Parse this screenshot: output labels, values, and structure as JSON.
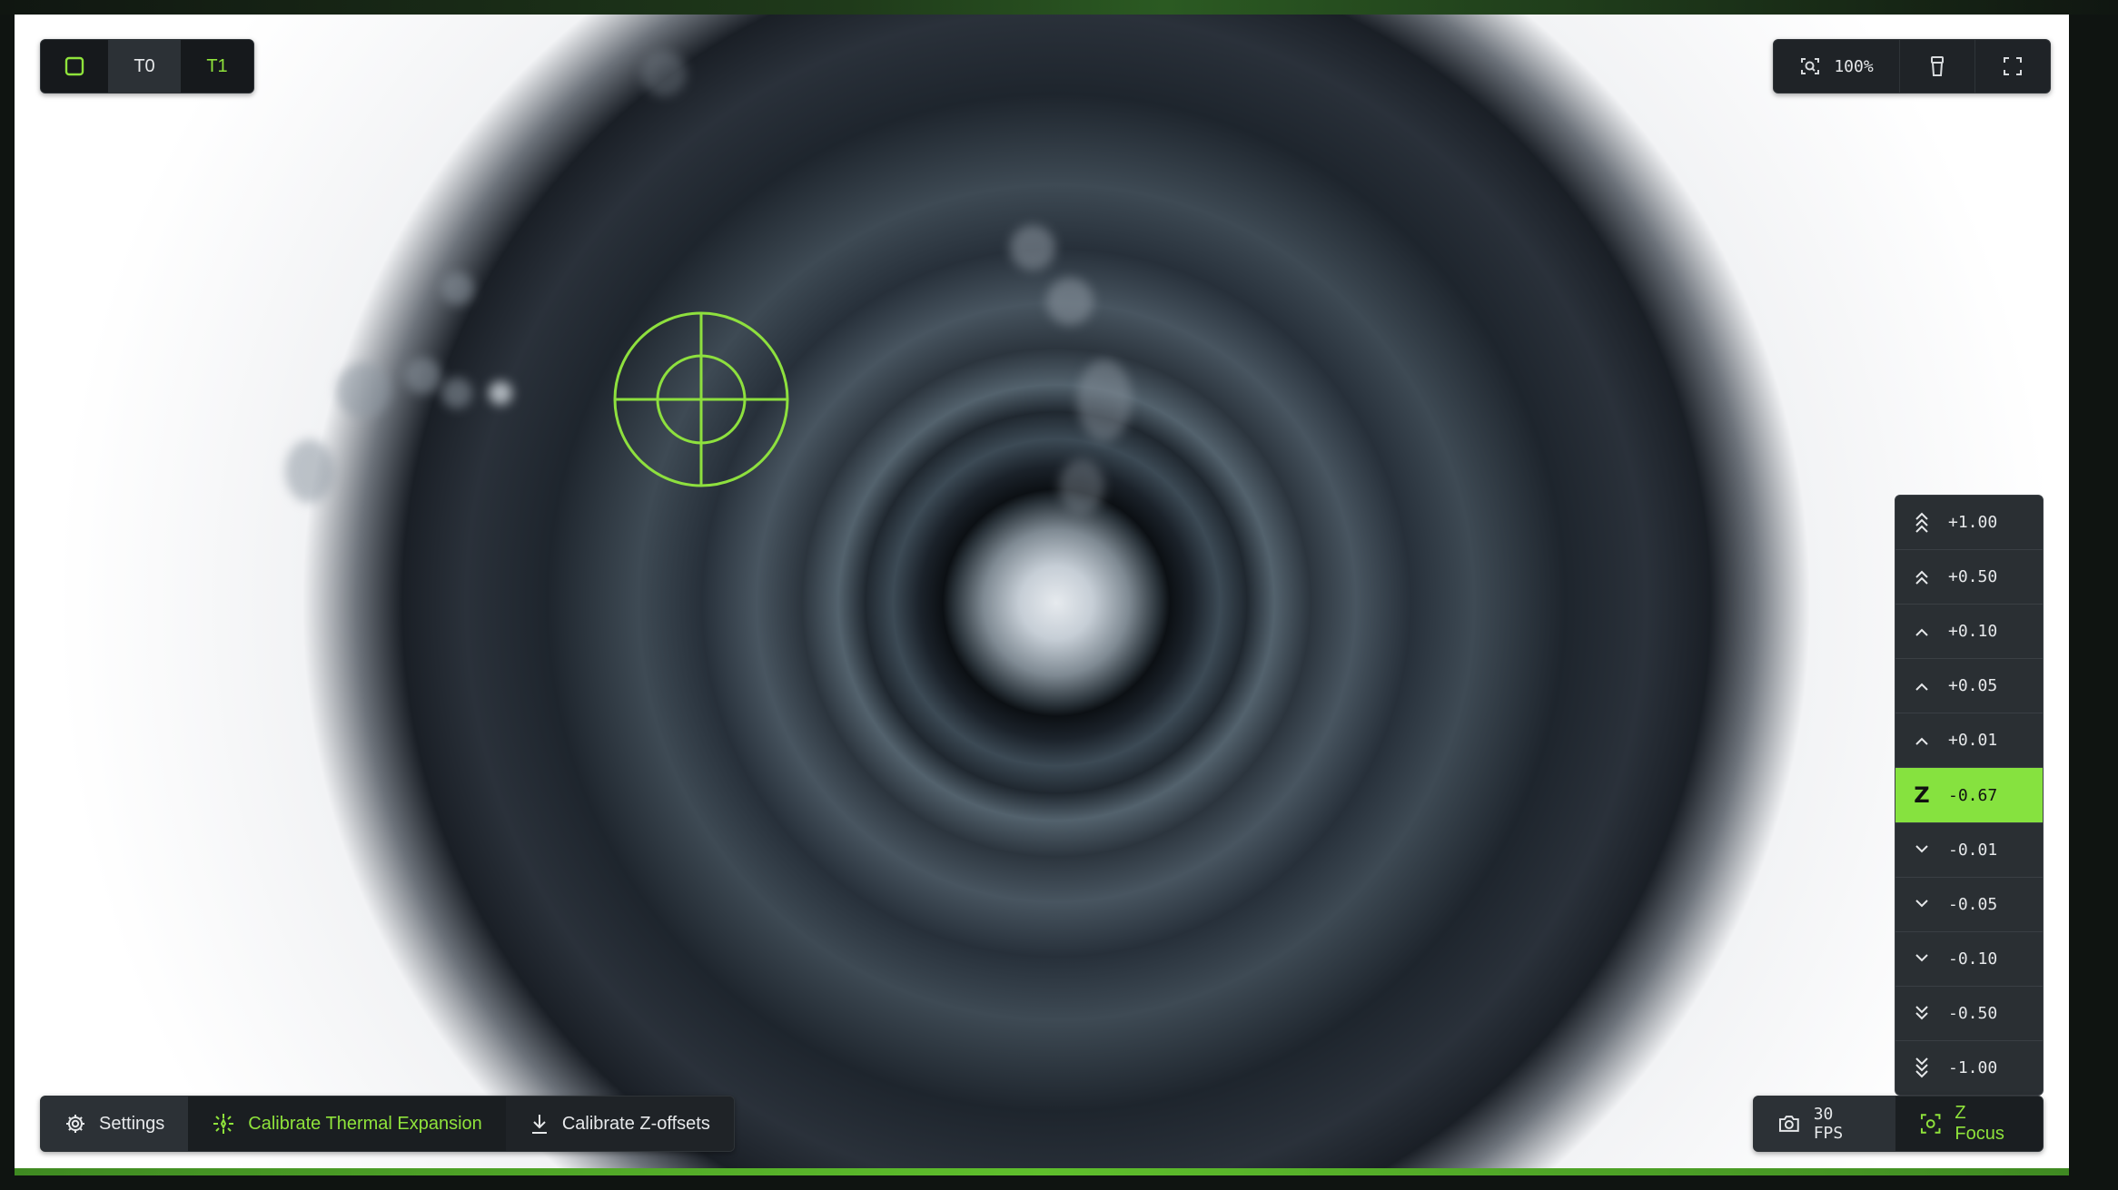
{
  "tool_selector": {
    "t0_label": "T0",
    "t1_label": "T1"
  },
  "view_controls": {
    "zoom_label": "100%"
  },
  "z_jog": {
    "up": [
      {
        "label": "+1.00",
        "icon": "chevrons-triple-up-icon"
      },
      {
        "label": "+0.50",
        "icon": "chevrons-double-up-icon"
      },
      {
        "label": "+0.10",
        "icon": "chevron-up-icon"
      },
      {
        "label": "+0.05",
        "icon": "chevron-up-icon"
      },
      {
        "label": "+0.01",
        "icon": "chevron-up-icon"
      }
    ],
    "current_axis": "Z",
    "current_value": "-0.67",
    "down": [
      {
        "label": "-0.01",
        "icon": "chevron-down-icon"
      },
      {
        "label": "-0.05",
        "icon": "chevron-down-icon"
      },
      {
        "label": "-0.10",
        "icon": "chevron-down-icon"
      },
      {
        "label": "-0.50",
        "icon": "chevrons-double-down-icon"
      },
      {
        "label": "-1.00",
        "icon": "chevrons-triple-down-icon"
      }
    ]
  },
  "bottom_actions": {
    "settings_label": "Settings",
    "calibrate_thermal_label": "Calibrate Thermal Expansion",
    "calibrate_z_label": "Calibrate Z-offsets"
  },
  "camera_status": {
    "fps_label": "30 FPS",
    "focus_label": "Z Focus"
  },
  "colors": {
    "accent": "#86e23f",
    "panel": "#1f2327"
  }
}
